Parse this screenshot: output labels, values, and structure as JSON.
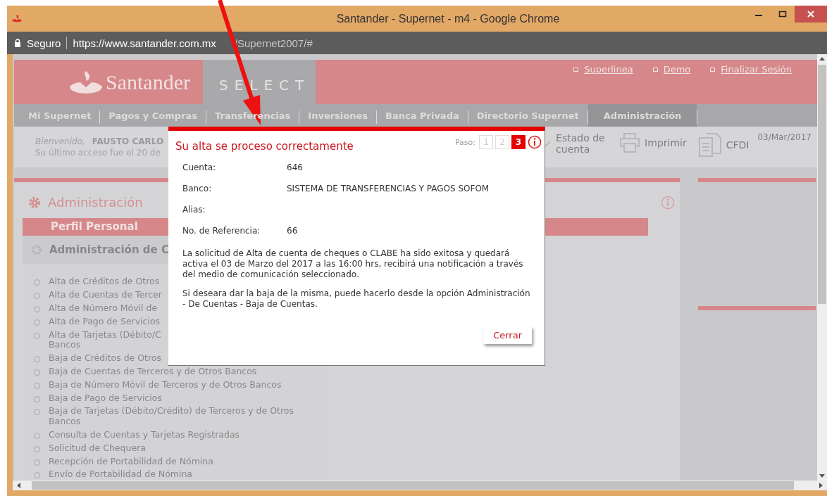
{
  "window": {
    "title": "Santander - Supernet - m4 - Google Chrome"
  },
  "address_bar": {
    "security": "Seguro",
    "url_host": "https://www.santander.com.mx",
    "url_path": "/Supernet2007/#"
  },
  "header": {
    "logo": "Santander",
    "brand": "SELECT",
    "links": [
      "Superlinea",
      "Demo",
      "Finalizar Sesión"
    ]
  },
  "nav": [
    {
      "label": "Mi Supernet",
      "selected": false
    },
    {
      "label": "Pagos y Compras",
      "selected": false
    },
    {
      "label": "Transferencias",
      "selected": false
    },
    {
      "label": "Inversiones",
      "selected": false
    },
    {
      "label": "Banca Privada",
      "selected": false
    },
    {
      "label": "Directorio Supernet",
      "selected": false
    },
    {
      "label": "Administración",
      "selected": true
    }
  ],
  "welcome": {
    "greeting": "Bienvenido,",
    "name": "FAUSTO CARLO",
    "last_access": "Su último acceso fue el 20 de"
  },
  "tools": [
    {
      "kind": "statement",
      "label": "Estado de cuenta"
    },
    {
      "kind": "print",
      "label": "Imprimir"
    },
    {
      "kind": "document",
      "label": "CFDI"
    }
  ],
  "date": "03/Mar/2017",
  "sidebar": {
    "title": "Administración",
    "section": "Perfil Personal",
    "group": "Administración de C",
    "items": [
      {
        "text": "Alta de Créditos de Otros",
        "selected": false
      },
      {
        "text": "Alta de Cuentas de Tercer",
        "selected": false
      },
      {
        "text": "Alta de Número Móvil de",
        "selected": false
      },
      {
        "text": "Alta de Pago de Servicios",
        "selected": false
      },
      {
        "text": "Alta de Tarjetas (Débito/C\nBancos",
        "selected": false
      },
      {
        "text": "Baja de Créditos de Otros",
        "selected": false
      },
      {
        "text": "Baja de Cuentas de Terceros y de Otros Bancos",
        "selected": false
      },
      {
        "text": "Baja de Número Móvil de Terceros y de Otros Bancos",
        "selected": false
      },
      {
        "text": "Baja de Pago de Servicios",
        "selected": false
      },
      {
        "text": "Baja de Tarjetas (Débito/Crédito) de Terceros y de Otros\nBancos",
        "selected": false
      },
      {
        "text": "Consulta de Cuentas y Tarjetas Registradas",
        "selected": false
      },
      {
        "text": "Solicitud de Chequera",
        "selected": false
      },
      {
        "text": "Recepción de Portabilidad de Nómina",
        "selected": false
      },
      {
        "text": "Envío de Portabilidad de Nómina",
        "selected": false
      }
    ]
  },
  "modal": {
    "title": "Su alta se proceso correctamente",
    "steps_label": "Paso:",
    "steps": [
      {
        "label": "1",
        "selected": false
      },
      {
        "label": "2",
        "selected": false
      },
      {
        "label": "3",
        "selected": true
      }
    ],
    "fields": [
      {
        "label": "Cuenta:",
        "value": "646"
      },
      {
        "label": "Banco:",
        "value": "SISTEMA DE TRANSFERENCIAS Y PAGOS SOFOM"
      },
      {
        "label": "Alias:"
      },
      {
        "label": "No. de Referencia:",
        "value": "66"
      }
    ],
    "paragraphs": [
      "La solicitud de Alta de cuenta de cheques o CLABE ha sido exitosa y quedará activa el 03 de Marzo del 2017 a las 16:00 hrs, recibirá una notificación a través del medio de comunicación seleccionado.",
      "Si deseara dar la baja de la misma, puede hacerlo desde la opción Administración - De Cuentas - Baja de Cuentas."
    ],
    "close_button": "Cerrar"
  }
}
